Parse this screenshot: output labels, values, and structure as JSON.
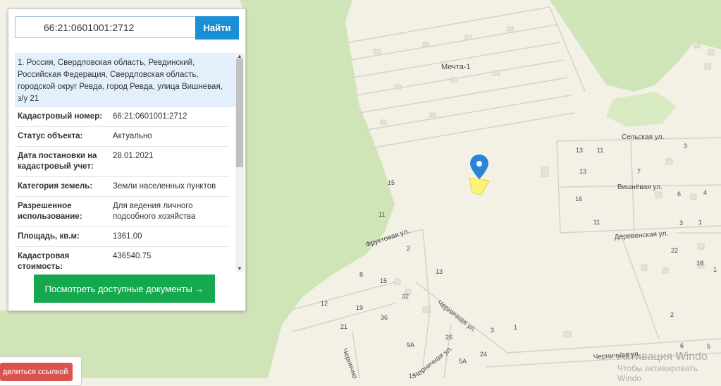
{
  "search": {
    "value": "66:21:0601001:2712",
    "button_label": "Найти"
  },
  "parcel": {
    "address": "1. Россия, Свердловская область, Ревдинский, Российская Федерация, Свердловская область, городской округ Ревда, город Ревда, улица Вишневая, з/у 21",
    "close_icon": "×",
    "rows": [
      {
        "label": "Кадастровый номер:",
        "value": "66:21:0601001:2712"
      },
      {
        "label": "Статус объекта:",
        "value": "Актуально"
      },
      {
        "label": "Дата постановки на кадастровый учет:",
        "value": "28.01.2021"
      },
      {
        "label": "Категория земель:",
        "value": "Земли населенных пунктов"
      },
      {
        "label": "Разрешенное использование:",
        "value": "Для ведения личного подсобного хозяйства"
      },
      {
        "label": "Площадь, кв.м:",
        "value": "1361.00"
      },
      {
        "label": "Кадастровая стоимость:",
        "value": "436540.75"
      }
    ],
    "docs_button": "Посмотреть доступные документы →"
  },
  "share_button": "делиться ссылкой",
  "map": {
    "labels": {
      "mechta": "Мечта-1",
      "selskaya": "Сельская ул.",
      "vishnevaya": "Вишнёвая ул.",
      "derevenskaya": "Деревенская ул.",
      "fruktovaya": "Фруктовая ул.",
      "chernichnaya1": "Черничная ул.",
      "chernichnaya2": "Черничная ул.",
      "chernichnaya3": "Черничная ул.",
      "chernichnaya4": "Черничная ул."
    },
    "numbers": [
      "13",
      "11",
      "3",
      "13",
      "7",
      "4",
      "6",
      "16",
      "11",
      "3",
      "1",
      "22",
      "18",
      "1",
      "15",
      "11",
      "2",
      "8",
      "15",
      "13",
      "12",
      "19",
      "32",
      "36",
      "21",
      "3",
      "1",
      "26",
      "9A",
      "24",
      "5A",
      "2",
      "6",
      "5",
      "15"
    ]
  },
  "watermark": {
    "line1": "Активация Windo",
    "line2": "Чтобы активировать Windo"
  },
  "colors": {
    "search_button": "#1b8fd6",
    "docs_button": "#16a84f",
    "forest": "#cfe5b8",
    "marker": "#2a84d8",
    "parcel": "#fff275"
  }
}
